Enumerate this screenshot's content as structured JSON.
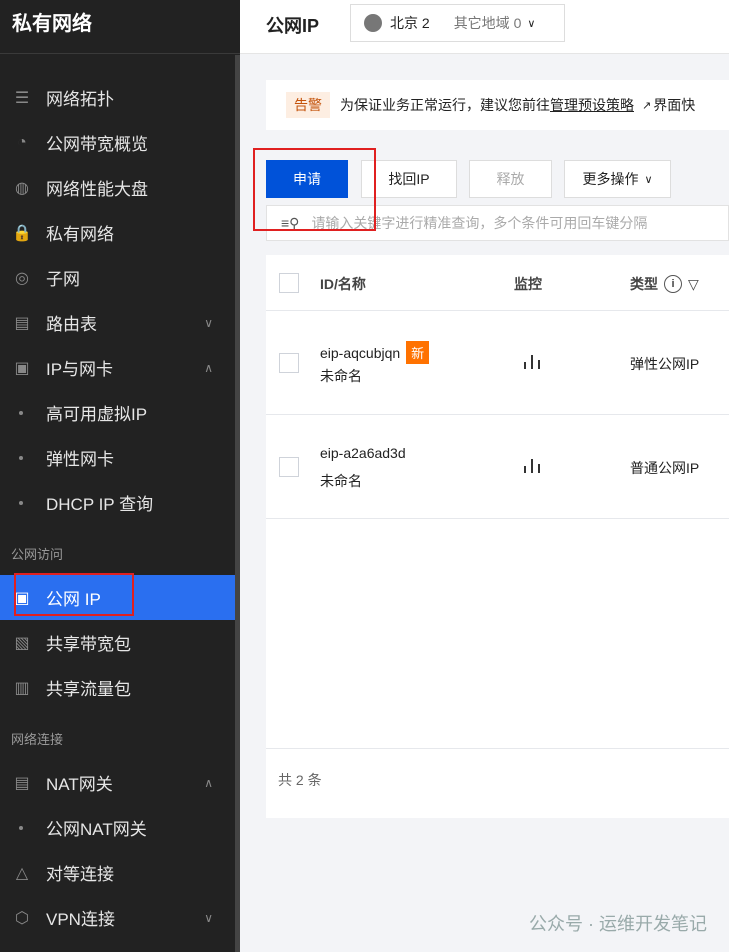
{
  "sidebar": {
    "title": "私有网络",
    "items": [
      {
        "label": "网络拓扑",
        "icon": "topology-icon"
      },
      {
        "label": "公网带宽概览",
        "icon": "bandwidth-icon"
      },
      {
        "label": "网络性能大盘",
        "icon": "performance-icon"
      },
      {
        "label": "私有网络",
        "icon": "lock-icon"
      },
      {
        "label": "子网",
        "icon": "globe-icon"
      },
      {
        "label": "路由表",
        "icon": "route-table-icon",
        "chevron": "down"
      },
      {
        "label": "IP与网卡",
        "icon": "nic-icon",
        "chevron": "up"
      },
      {
        "label": "高可用虚拟IP",
        "sub": true
      },
      {
        "label": "弹性网卡",
        "sub": true
      },
      {
        "label": "DHCP IP 查询",
        "sub": true
      }
    ],
    "section1": "公网访问",
    "items2": [
      {
        "label": "公网 IP",
        "icon": "ip-icon",
        "active": true
      },
      {
        "label": "共享带宽包",
        "icon": "bandwidth-package-icon"
      },
      {
        "label": "共享流量包",
        "icon": "traffic-package-icon"
      }
    ],
    "section2": "网络连接",
    "items3": [
      {
        "label": "NAT网关",
        "icon": "nat-icon",
        "chevron": "up"
      },
      {
        "label": "公网NAT网关",
        "sub": true
      },
      {
        "label": "对等连接",
        "icon": "peering-icon"
      },
      {
        "label": "VPN连接",
        "icon": "vpn-icon",
        "chevron": "down"
      }
    ]
  },
  "header": {
    "title": "公网IP",
    "region": "北京 2",
    "other_region": "其它地域 0"
  },
  "alert": {
    "tag": "告警",
    "text": "为保证业务正常运行，建议您前往",
    "link": "管理预设策略",
    "text2": "界面快"
  },
  "toolbar": {
    "apply": "申请",
    "recover": "找回IP",
    "release": "释放",
    "more": "更多操作"
  },
  "search": {
    "placeholder": "请输入关键字进行精准查询，多个条件可用回车键分隔"
  },
  "table": {
    "columns": [
      "ID/名称",
      "监控",
      "类型"
    ],
    "rows": [
      {
        "id": "eip-aqcubjqn",
        "name": "未命名",
        "badge": "新",
        "type": "弹性公网IP"
      },
      {
        "id": "eip-a2a6ad3d",
        "name": "未命名",
        "type": "普通公网IP"
      }
    ],
    "total": "共 2 条"
  },
  "watermark": "公众号 · 运维开发笔记",
  "colors": {
    "sidebar": "#222222",
    "active": "#2a6ff0",
    "primary": "#0052d9",
    "badge": "#ff7200",
    "highlight": "#e02020"
  }
}
